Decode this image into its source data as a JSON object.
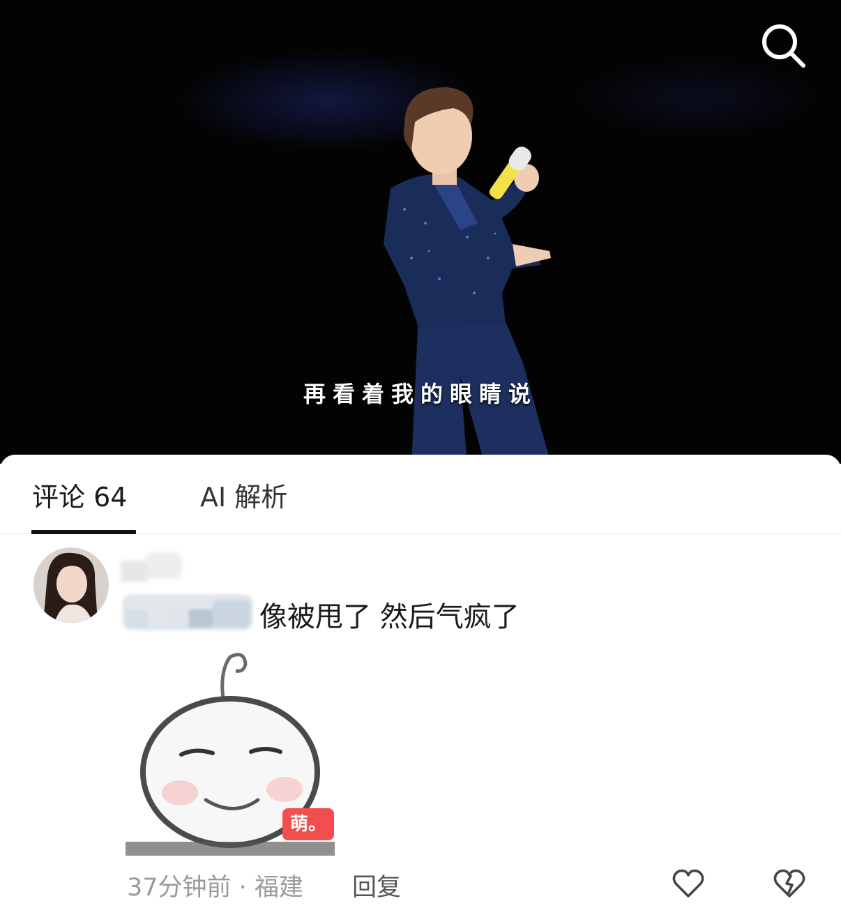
{
  "video": {
    "subtitle": "再看着我的眼睛说",
    "search_icon": "search-icon"
  },
  "tabs": [
    {
      "label": "评论 64",
      "active": true
    },
    {
      "label": "AI 解析",
      "active": false
    }
  ],
  "comment": {
    "text": "像被甩了 然后气疯了",
    "sticker_badge": "萌。",
    "time_location": "37分钟前 · 福建",
    "reply_label": "回复",
    "like_icon": "heart-outline-icon",
    "dislike_icon": "broken-heart-icon"
  },
  "colors": {
    "badge_red": "#f24d4f",
    "meta_gray": "#9a9a9a",
    "text_dark": "#1a1a1a"
  }
}
